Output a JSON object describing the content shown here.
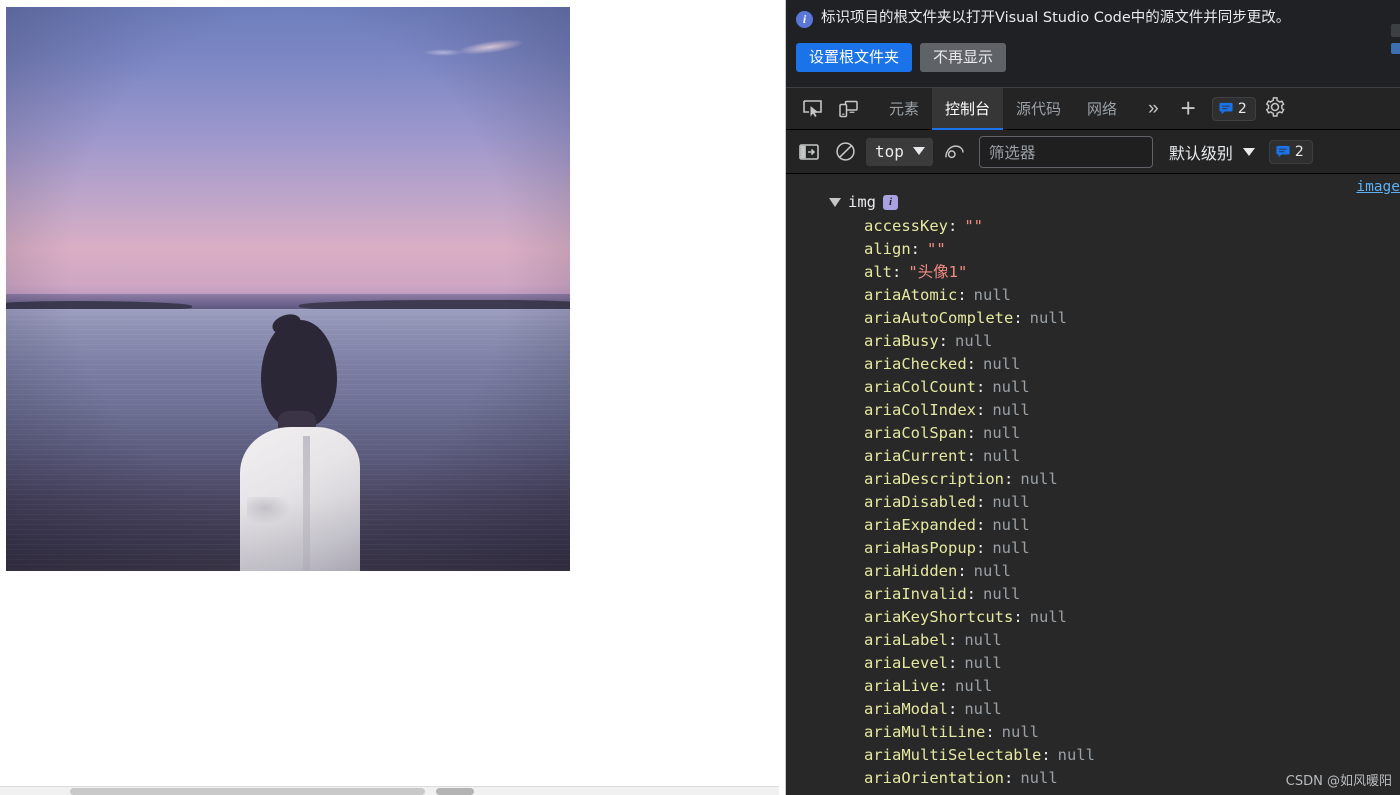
{
  "page": {
    "photo_alt": "头像1",
    "photo_description": "A person in a white shirt seen from behind, standing at a lake at dusk with a pink and blue sunset sky"
  },
  "notice": {
    "icon": "info-icon",
    "message": "标识项目的根文件夹以打开Visual Studio Code中的源文件并同步更改。",
    "primary_button": "设置根文件夹",
    "secondary_button": "不再显示"
  },
  "tabstrip": {
    "inspect_icon": "inspect-element-icon",
    "device_icon": "device-toolbar-icon",
    "tabs": [
      {
        "label": "元素",
        "active": false
      },
      {
        "label": "控制台",
        "active": true
      },
      {
        "label": "源代码",
        "active": false
      },
      {
        "label": "网络",
        "active": false
      }
    ],
    "more_icon": "chevron-double-right-icon",
    "plus_icon": "plus-icon",
    "issues_badge": "2",
    "settings_icon": "gear-icon"
  },
  "consolebar": {
    "sidebar_icon": "console-sidebar-icon",
    "clear_icon": "clear-console-icon",
    "context": "top",
    "eye_icon": "live-expression-icon",
    "filter_placeholder": "筛选器",
    "filter_value": "",
    "level": "默认级别",
    "issues_badge": "2"
  },
  "console": {
    "source_link": "image",
    "object": {
      "expander": "triangle-down-icon",
      "name": "img",
      "info_badge": "info-badge-icon"
    },
    "properties": [
      {
        "key": "accessKey",
        "value": "\"\"",
        "type": "string"
      },
      {
        "key": "align",
        "value": "\"\"",
        "type": "string"
      },
      {
        "key": "alt",
        "value": "\"头像1\"",
        "type": "string"
      },
      {
        "key": "ariaAtomic",
        "value": "null",
        "type": "null"
      },
      {
        "key": "ariaAutoComplete",
        "value": "null",
        "type": "null"
      },
      {
        "key": "ariaBusy",
        "value": "null",
        "type": "null"
      },
      {
        "key": "ariaChecked",
        "value": "null",
        "type": "null"
      },
      {
        "key": "ariaColCount",
        "value": "null",
        "type": "null"
      },
      {
        "key": "ariaColIndex",
        "value": "null",
        "type": "null"
      },
      {
        "key": "ariaColSpan",
        "value": "null",
        "type": "null"
      },
      {
        "key": "ariaCurrent",
        "value": "null",
        "type": "null"
      },
      {
        "key": "ariaDescription",
        "value": "null",
        "type": "null"
      },
      {
        "key": "ariaDisabled",
        "value": "null",
        "type": "null"
      },
      {
        "key": "ariaExpanded",
        "value": "null",
        "type": "null"
      },
      {
        "key": "ariaHasPopup",
        "value": "null",
        "type": "null"
      },
      {
        "key": "ariaHidden",
        "value": "null",
        "type": "null"
      },
      {
        "key": "ariaInvalid",
        "value": "null",
        "type": "null"
      },
      {
        "key": "ariaKeyShortcuts",
        "value": "null",
        "type": "null"
      },
      {
        "key": "ariaLabel",
        "value": "null",
        "type": "null"
      },
      {
        "key": "ariaLevel",
        "value": "null",
        "type": "null"
      },
      {
        "key": "ariaLive",
        "value": "null",
        "type": "null"
      },
      {
        "key": "ariaModal",
        "value": "null",
        "type": "null"
      },
      {
        "key": "ariaMultiLine",
        "value": "null",
        "type": "null"
      },
      {
        "key": "ariaMultiSelectable",
        "value": "null",
        "type": "null"
      },
      {
        "key": "ariaOrientation",
        "value": "null",
        "type": "null"
      }
    ]
  },
  "watermark": "CSDN @如风暖阳",
  "colors": {
    "accent": "#1a73e8",
    "panel_bg": "#242424",
    "console_bg": "#282828",
    "key": "#e5e8a0",
    "string": "#f28b82",
    "null": "#9aa0a6",
    "link": "#5db0f5"
  }
}
